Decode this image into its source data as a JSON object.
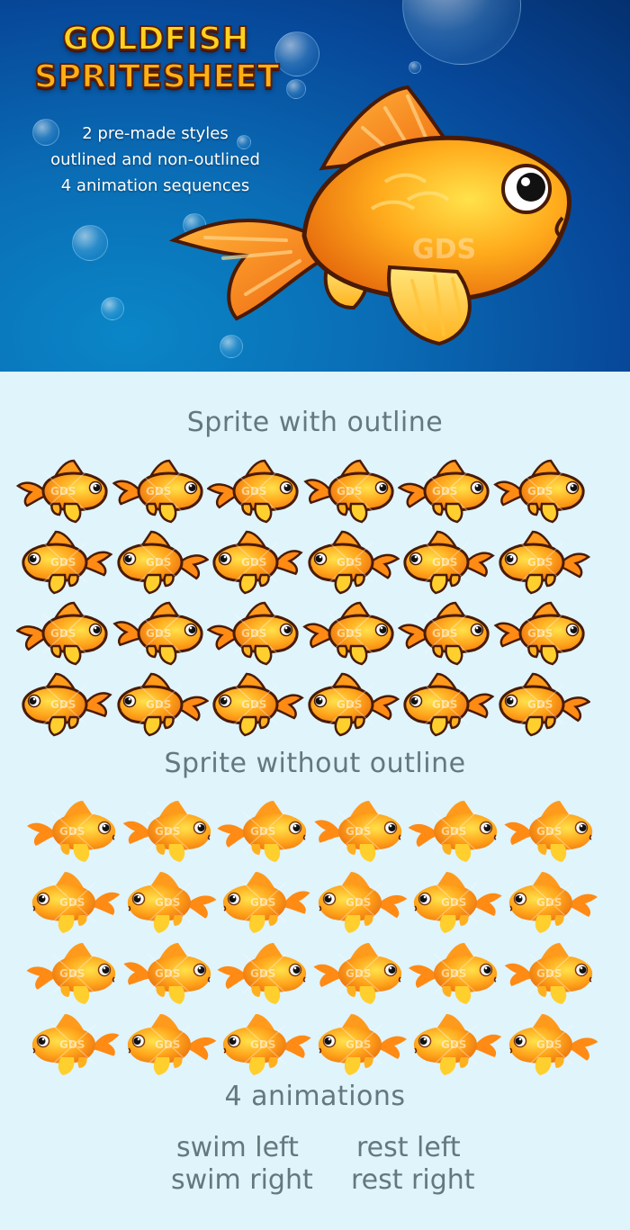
{
  "banner": {
    "title_line1": "GOLDFISH",
    "title_line2": "SPRITESHEET",
    "features": [
      "2 pre-made styles",
      "outlined and non-outlined",
      "4 animation sequences"
    ],
    "watermark": "GDS"
  },
  "sections": {
    "outlined_heading": "Sprite with outline",
    "plain_heading": "Sprite without outline",
    "animations_heading": "4 animations"
  },
  "animations": {
    "swim_left": "swim left",
    "swim_right": "swim right",
    "rest_left": "rest left",
    "rest_right": "rest right"
  },
  "sprite_grid": {
    "rows": 4,
    "columns": 6,
    "row_directions": [
      "right",
      "left",
      "right",
      "left"
    ]
  },
  "colors": {
    "ocean_dark": "#04306f",
    "ocean_light": "#0a86c7",
    "fish_body": "#ff9a12",
    "fish_belly": "#ffd23a",
    "heading_gray": "#63787f",
    "background": "#dff4fb"
  }
}
